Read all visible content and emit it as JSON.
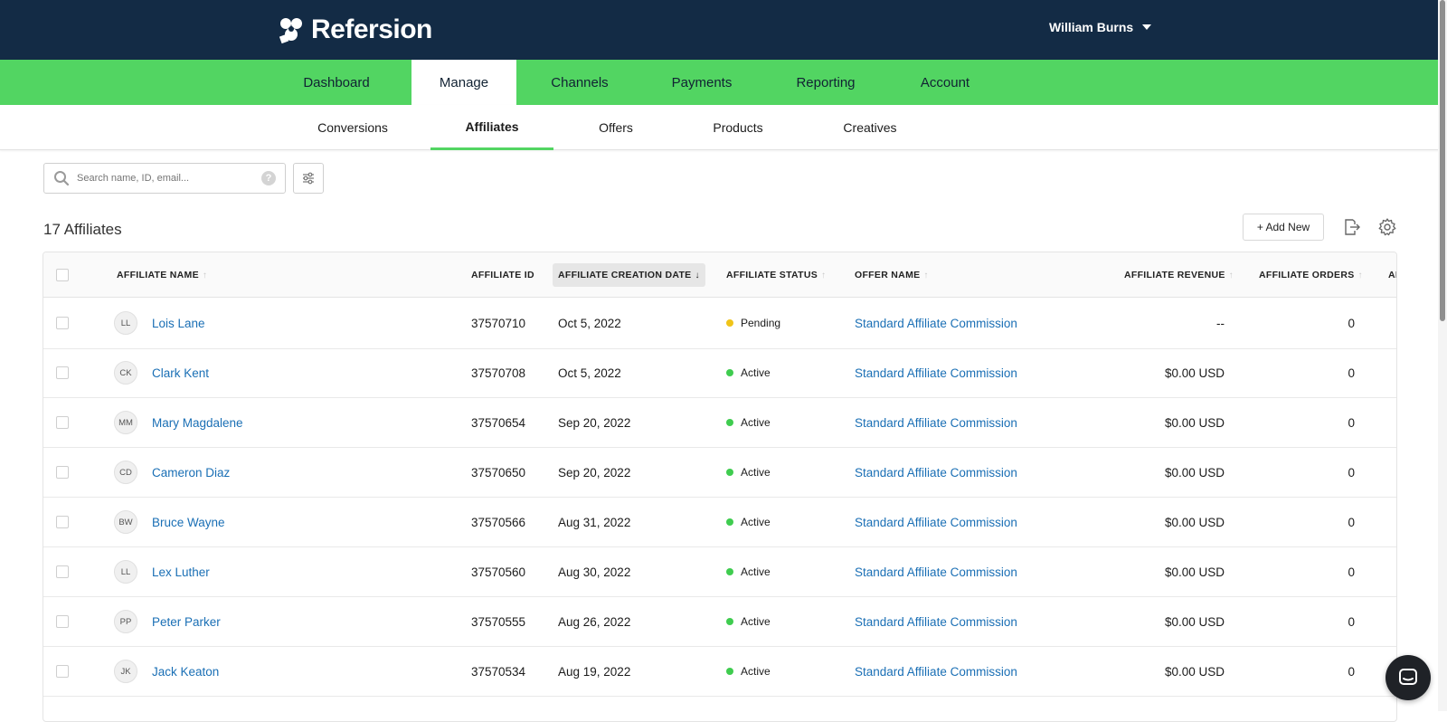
{
  "brand": {
    "name": "Refersion",
    "nav_bg": "#132b45",
    "accent": "#52d562",
    "link": "#1a6fb5"
  },
  "user": {
    "name": "William Burns"
  },
  "main_nav": {
    "tabs": [
      {
        "label": "Dashboard"
      },
      {
        "label": "Manage",
        "active": true
      },
      {
        "label": "Channels"
      },
      {
        "label": "Payments"
      },
      {
        "label": "Reporting"
      },
      {
        "label": "Account"
      }
    ]
  },
  "sub_nav": {
    "tabs": [
      {
        "label": "Conversions"
      },
      {
        "label": "Affiliates",
        "active": true
      },
      {
        "label": "Offers"
      },
      {
        "label": "Products"
      },
      {
        "label": "Creatives"
      }
    ]
  },
  "search": {
    "placeholder": "Search name, ID, email...",
    "help": "?"
  },
  "toolbar": {
    "count_label": "17 Affiliates",
    "add_label": "+ Add New",
    "export_icon": "export-icon",
    "settings_icon": "gear-icon"
  },
  "table": {
    "columns": [
      {
        "label": "AFFILIATE NAME",
        "sortable": true
      },
      {
        "label": "AFFILIATE ID",
        "sortable": false
      },
      {
        "label": "AFFILIATE CREATION DATE",
        "sortable": true,
        "sorted": "desc"
      },
      {
        "label": "AFFILIATE STATUS",
        "sortable": true
      },
      {
        "label": "OFFER NAME",
        "sortable": true
      },
      {
        "label": "AFFILIATE REVENUE",
        "sortable": true
      },
      {
        "label": "AFFILIATE ORDERS",
        "sortable": true
      },
      {
        "label": "AI"
      }
    ],
    "rows": [
      {
        "initials": "LL",
        "name": "Lois Lane",
        "id": "37570710",
        "date": "Oct 5, 2022",
        "status": "Pending",
        "status_color": "#f0c419",
        "offer": "Standard Affiliate Commission",
        "revenue": "--",
        "orders": "0"
      },
      {
        "initials": "CK",
        "name": "Clark Kent",
        "id": "37570708",
        "date": "Oct 5, 2022",
        "status": "Active",
        "status_color": "#3fcc4f",
        "offer": "Standard Affiliate Commission",
        "revenue": "$0.00 USD",
        "orders": "0"
      },
      {
        "initials": "MM",
        "name": "Mary Magdalene",
        "id": "37570654",
        "date": "Sep 20, 2022",
        "status": "Active",
        "status_color": "#3fcc4f",
        "offer": "Standard Affiliate Commission",
        "revenue": "$0.00 USD",
        "orders": "0"
      },
      {
        "initials": "CD",
        "name": "Cameron Diaz",
        "id": "37570650",
        "date": "Sep 20, 2022",
        "status": "Active",
        "status_color": "#3fcc4f",
        "offer": "Standard Affiliate Commission",
        "revenue": "$0.00 USD",
        "orders": "0"
      },
      {
        "initials": "BW",
        "name": "Bruce Wayne",
        "id": "37570566",
        "date": "Aug 31, 2022",
        "status": "Active",
        "status_color": "#3fcc4f",
        "offer": "Standard Affiliate Commission",
        "revenue": "$0.00 USD",
        "orders": "0"
      },
      {
        "initials": "LL",
        "name": "Lex Luther",
        "id": "37570560",
        "date": "Aug 30, 2022",
        "status": "Active",
        "status_color": "#3fcc4f",
        "offer": "Standard Affiliate Commission",
        "revenue": "$0.00 USD",
        "orders": "0"
      },
      {
        "initials": "PP",
        "name": "Peter Parker",
        "id": "37570555",
        "date": "Aug 26, 2022",
        "status": "Active",
        "status_color": "#3fcc4f",
        "offer": "Standard Affiliate Commission",
        "revenue": "$0.00 USD",
        "orders": "0"
      },
      {
        "initials": "JK",
        "name": "Jack Keaton",
        "id": "37570534",
        "date": "Aug 19, 2022",
        "status": "Active",
        "status_color": "#3fcc4f",
        "offer": "Standard Affiliate Commission",
        "revenue": "$0.00 USD",
        "orders": "0"
      }
    ]
  }
}
